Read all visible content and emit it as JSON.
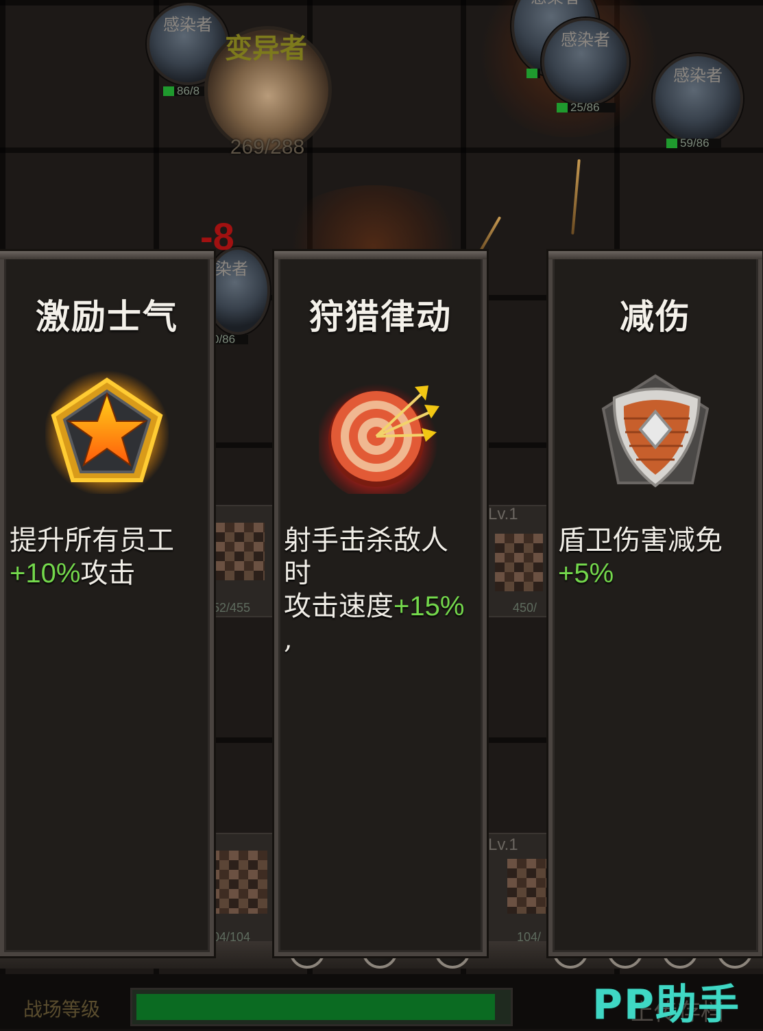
{
  "battlefield": {
    "boss": {
      "name": "变异者",
      "hp": "269/288"
    },
    "enemies": [
      {
        "name": "感染者",
        "hp": "86/8"
      },
      {
        "name": "感染者",
        "hp": ""
      },
      {
        "name": "感染者",
        "hp": "25/86"
      },
      {
        "name": "感染者",
        "hp": "59/86"
      },
      {
        "name": "染者",
        "hp": "0/86"
      }
    ],
    "damage_popup": "-8",
    "units": [
      {
        "label": "",
        "hp": "52/455"
      },
      {
        "label": "Lv.1",
        "hp": "450/"
      },
      {
        "label": "",
        "hp": "04/104"
      },
      {
        "label": "Lv.1",
        "hp": "104/"
      }
    ]
  },
  "cards": [
    {
      "title": "激励士气",
      "icon": "star-badge-icon",
      "desc_line1": "提升所有员工",
      "bonus": "+10%",
      "desc_after_bonus": "攻击"
    },
    {
      "title": "狩猎律动",
      "icon": "target-arrows-icon",
      "desc_line1": "射手击杀敌人",
      "desc_line2": "时",
      "desc_line3": "攻击速度",
      "bonus": "+15%",
      "desc_line4": ","
    },
    {
      "title": "减伤",
      "icon": "shield-badge-icon",
      "desc_line1": "盾卫伤害减免",
      "bonus": "+5%"
    }
  ],
  "footer": {
    "label": "战场等级",
    "progress": 0.97,
    "upload_text": "上传存档"
  },
  "watermark": "PP助手",
  "colors": {
    "bonus_green": "#74d84c",
    "progress_green": "#0b6b22",
    "watermark": "#3fd7c4"
  }
}
